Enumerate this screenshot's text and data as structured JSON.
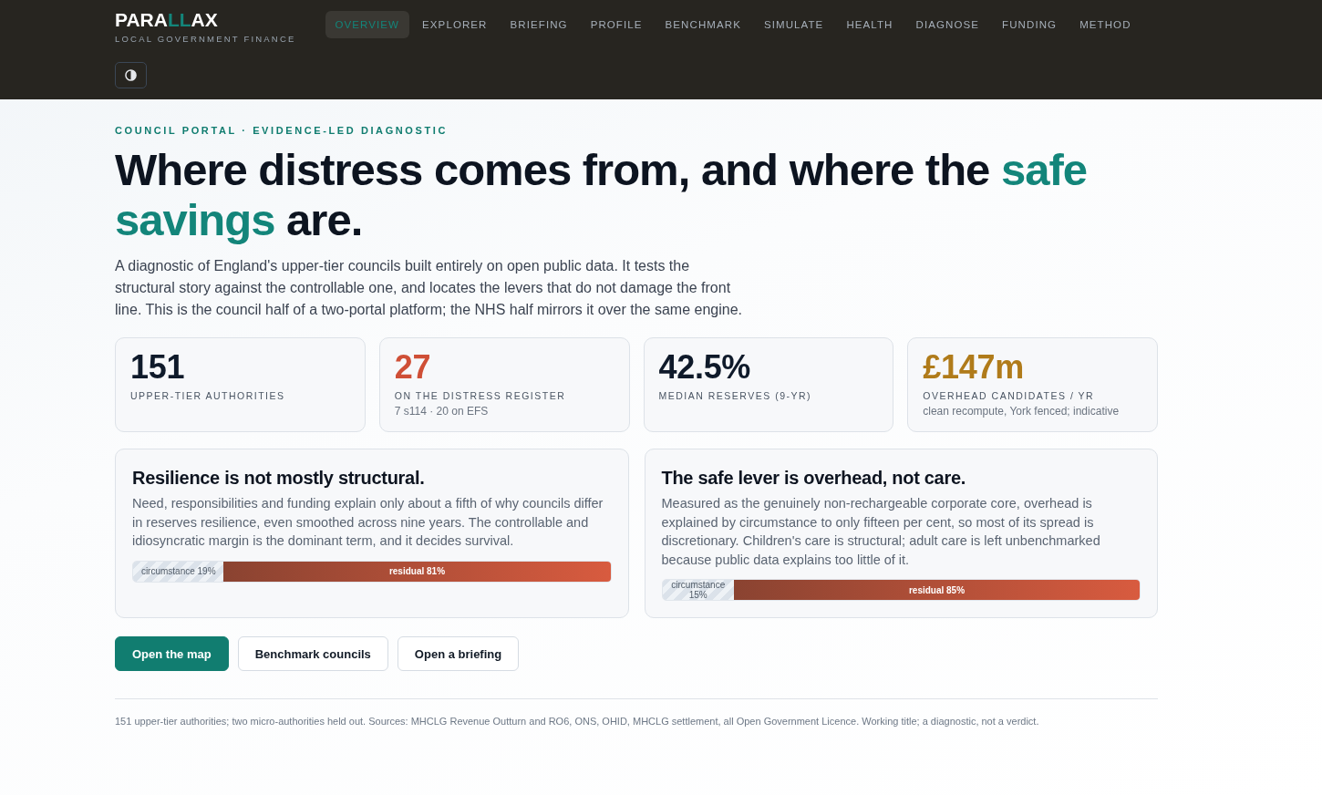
{
  "brand": {
    "logo": [
      {
        "text": "PARA",
        "accent": false
      },
      {
        "text": "LL",
        "accent": true
      },
      {
        "text": "AX",
        "accent": false
      }
    ],
    "tagline": "LOCAL GOVERNMENT FINANCE"
  },
  "nav": [
    {
      "label": "OVERVIEW",
      "selected": true
    },
    {
      "label": "EXPLORER",
      "selected": false
    },
    {
      "label": "BRIEFING",
      "selected": false
    },
    {
      "label": "PROFILE",
      "selected": false
    },
    {
      "label": "BENCHMARK",
      "selected": false
    },
    {
      "label": "SIMULATE",
      "selected": false
    },
    {
      "label": "HEALTH",
      "selected": false
    },
    {
      "label": "DIAGNOSE",
      "selected": false
    },
    {
      "label": "FUNDING",
      "selected": false
    },
    {
      "label": "METHOD",
      "selected": false
    }
  ],
  "hero": {
    "eyebrow": "COUNCIL PORTAL · EVIDENCE-LED DIAGNOSTIC",
    "headline": [
      {
        "text": "Where distress comes from, and where the ",
        "highlight": false
      },
      {
        "text": "safe savings",
        "highlight": true
      },
      {
        "text": " are.",
        "highlight": false
      }
    ],
    "intro": "A diagnostic of England's upper-tier councils built entirely on open public data. It tests the structural story against the controllable one, and locates the levers that do not damage the front line. This is the council half of a two-portal platform; the NHS half mirrors it over the same engine."
  },
  "stats": [
    {
      "value": "151",
      "label": "UPPER-TIER AUTHORITIES",
      "color": "#0f1a2a"
    },
    {
      "value": "27",
      "label": "ON THE DISTRESS REGISTER",
      "note": "7 s114 · 20 on EFS",
      "color": "#cf4f36"
    },
    {
      "value": "42.5%",
      "label": "MEDIAN RESERVES (9-YR)",
      "color": "#0f1a2a"
    },
    {
      "value": "£147m",
      "label": "OVERHEAD CANDIDATES / YR",
      "note": "clean recompute, York fenced; indicative",
      "color": "#b07b1a"
    }
  ],
  "findings": [
    {
      "title": "Resilience is not mostly structural.",
      "text": "Need, responsibilities and funding explain only about a fifth of why councils differ in reserves resilience, even smoothed across nine years. The controllable and idiosyncratic margin is the dominant term, and it decides survival.",
      "split": {
        "level": 0.19,
        "circumstance_label": "circumstance 19%",
        "residual_label": "residual 81%"
      }
    },
    {
      "title": "The safe lever is overhead, not care.",
      "text": "Measured as the genuinely non-rechargeable corporate core, overhead is explained by circumstance to only fifteen per cent, so most of its spread is discretionary. Children's care is structural; adult care is left unbenchmarked because public data explains too little of it.",
      "split": {
        "level": 0.15,
        "circumstance_label": "circumstance 15%",
        "residual_label": "residual 85%"
      }
    }
  ],
  "actions": [
    {
      "label": "Open the map",
      "kind": "primary"
    },
    {
      "label": "Benchmark councils",
      "kind": "secondary"
    },
    {
      "label": "Open a briefing",
      "kind": "secondary"
    }
  ],
  "footnote": "151 upper-tier authorities; two micro-authorities held out. Sources: MHCLG Revenue Outturn and RO6, ONS, OHID, MHCLG settlement, all Open Government Licence. Working title; a diagnostic, not a verdict."
}
